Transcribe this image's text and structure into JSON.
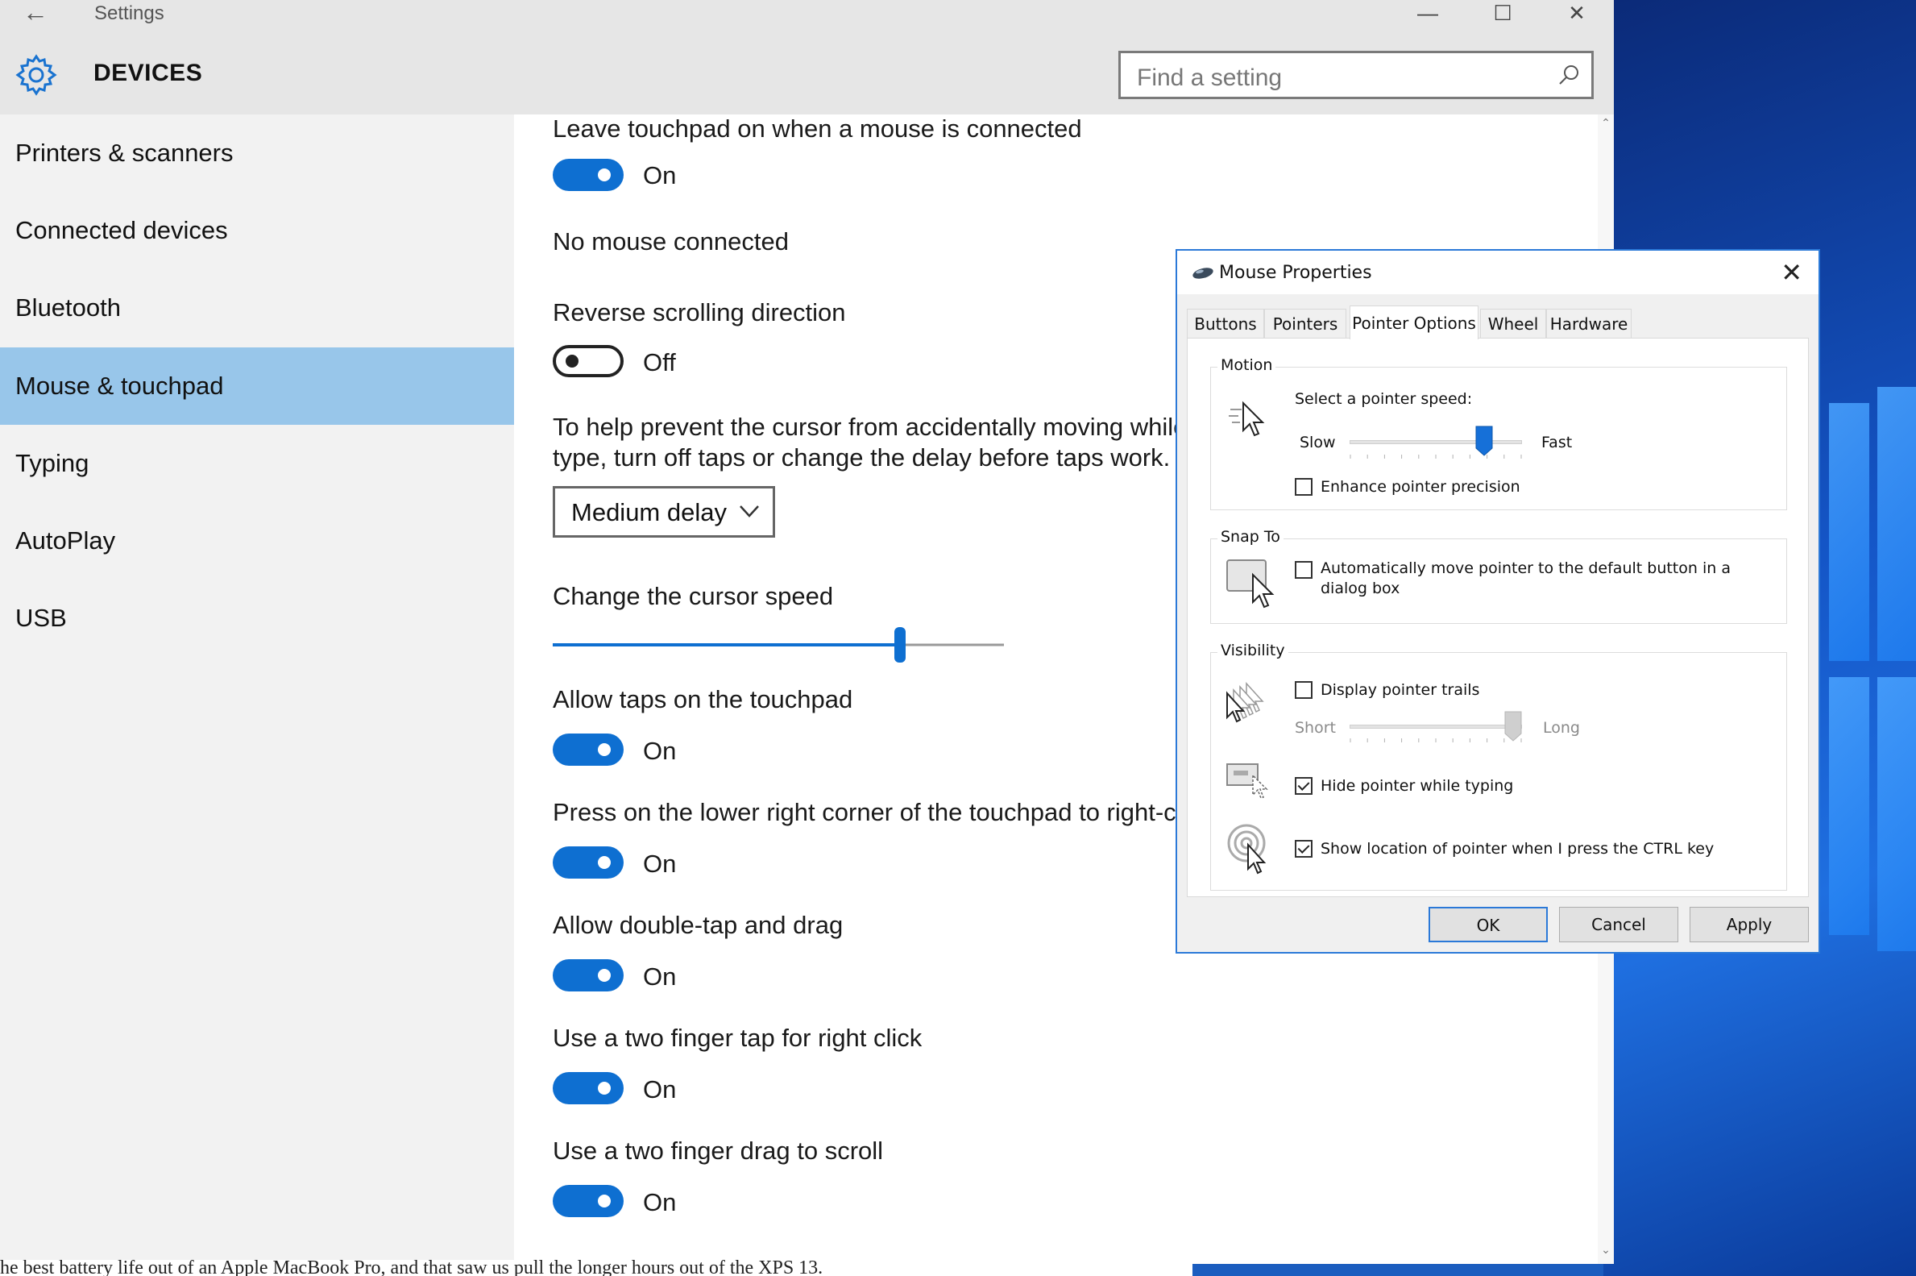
{
  "settings": {
    "window_title": "Settings",
    "section_title": "DEVICES",
    "search": {
      "placeholder": "Find a setting"
    },
    "sidebar": {
      "items": [
        {
          "label": "Printers & scanners"
        },
        {
          "label": "Connected devices"
        },
        {
          "label": "Bluetooth"
        },
        {
          "label": "Mouse & touchpad",
          "selected": true
        },
        {
          "label": "Typing"
        },
        {
          "label": "AutoPlay"
        },
        {
          "label": "USB"
        }
      ]
    },
    "content": {
      "leave_touchpad_label": "Leave touchpad on when a mouse is connected",
      "leave_touchpad_state": "On",
      "no_mouse_text": "No mouse connected",
      "reverse_scroll_label": "Reverse scrolling direction",
      "reverse_scroll_state": "Off",
      "help_text_line1": "To help prevent the cursor from accidentally moving while",
      "help_text_line2": "type, turn off taps or change the delay before taps work.",
      "delay_value": "Medium delay",
      "cursor_speed_label": "Change the cursor speed",
      "cursor_speed_level": 0.77,
      "allow_taps_label": "Allow taps on the touchpad",
      "allow_taps_state": "On",
      "press_corner_label": "Press on the lower right corner of the touchpad to right-cli",
      "press_corner_state": "On",
      "double_tap_label": "Allow double-tap and drag",
      "double_tap_state": "On",
      "two_finger_tap_label": "Use a two finger tap for right click",
      "two_finger_tap_state": "On",
      "two_finger_drag_label": "Use a two finger drag to scroll",
      "two_finger_drag_state": "On"
    }
  },
  "article_text": "he best battery life out of an Apple MacBook Pro, and that saw us pull the longer hours out of the XPS 13.",
  "dialog": {
    "title": "Mouse Properties",
    "tabs": [
      "Buttons",
      "Pointers",
      "Pointer Options",
      "Wheel",
      "Hardware"
    ],
    "active_tab": "Pointer Options",
    "motion": {
      "group_label": "Motion",
      "speed_label": "Select a pointer speed:",
      "slow": "Slow",
      "fast": "Fast",
      "speed_level": 0.78,
      "enhance_label": "Enhance pointer precision",
      "enhance_checked": false
    },
    "snap_to": {
      "group_label": "Snap To",
      "auto_move_line1": "Automatically move pointer to the default button in a",
      "auto_move_line2": "dialog box",
      "auto_move_checked": false
    },
    "visibility": {
      "group_label": "Visibility",
      "trails_label": "Display pointer trails",
      "trails_checked": false,
      "short": "Short",
      "long": "Long",
      "trails_level": 0.95,
      "hide_label": "Hide pointer while typing",
      "hide_checked": true,
      "ctrl_label": "Show location of pointer when I press the CTRL key",
      "ctrl_checked": true
    },
    "buttons": {
      "ok": "OK",
      "cancel": "Cancel",
      "apply": "Apply"
    }
  },
  "colors": {
    "accent": "#0e6fd1",
    "selected_nav": "#98c6ea",
    "dialog_border": "#2b79d8"
  }
}
